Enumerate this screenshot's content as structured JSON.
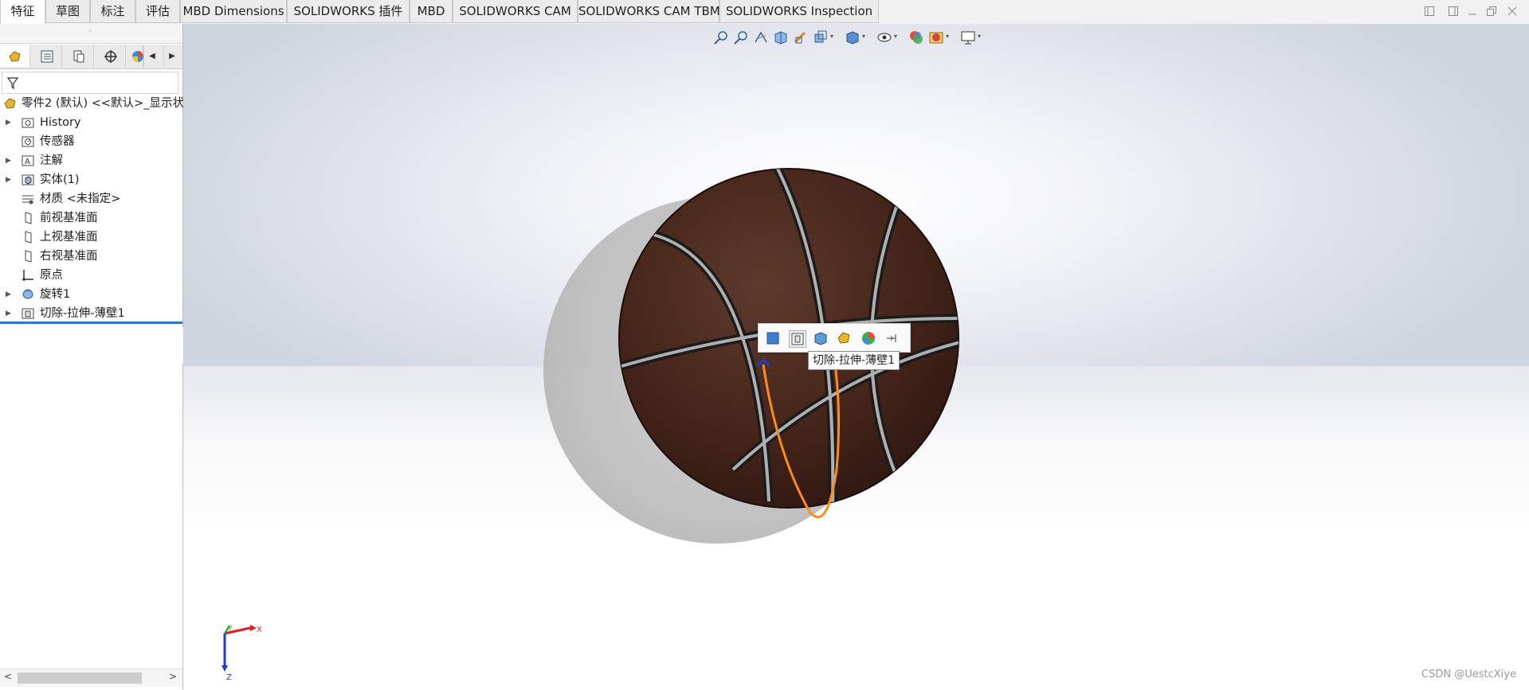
{
  "tabs": [
    {
      "label": "特征",
      "active": true
    },
    {
      "label": "草图"
    },
    {
      "label": "标注"
    },
    {
      "label": "评估"
    },
    {
      "label": "MBD Dimensions"
    },
    {
      "label": "SOLIDWORKS 插件"
    },
    {
      "label": "MBD"
    },
    {
      "label": "SOLIDWORKS CAM"
    },
    {
      "label": "SOLIDWORKS CAM TBM"
    },
    {
      "label": "SOLIDWORKS Inspection"
    }
  ],
  "feature_tree": {
    "root": "零件2 (默认) <<默认>_显示状",
    "items": [
      {
        "label": "History",
        "expandable": true,
        "icon": "history-folder-icon"
      },
      {
        "label": "传感器",
        "expandable": false,
        "icon": "sensor-icon"
      },
      {
        "label": "注解",
        "expandable": true,
        "icon": "annotation-icon"
      },
      {
        "label": "实体(1)",
        "expandable": true,
        "icon": "solid-bodies-icon"
      },
      {
        "label": "材质 <未指定>",
        "expandable": false,
        "icon": "material-icon"
      },
      {
        "label": "前视基准面",
        "expandable": false,
        "icon": "plane-icon"
      },
      {
        "label": "上视基准面",
        "expandable": false,
        "icon": "plane-icon"
      },
      {
        "label": "右视基准面",
        "expandable": false,
        "icon": "plane-icon"
      },
      {
        "label": "原点",
        "expandable": false,
        "icon": "origin-icon"
      },
      {
        "label": "旋转1",
        "expandable": true,
        "icon": "revolve-icon"
      },
      {
        "label": "切除-拉伸-薄壁1",
        "expandable": true,
        "icon": "cut-extrude-icon"
      }
    ]
  },
  "context_toolbar": {
    "tooltip": "切除-拉伸-薄壁1",
    "icons": [
      "edit-feature-icon",
      "edit-sketch-icon",
      "hide-body-icon",
      "appearance-icon",
      "display-pane-icon",
      "pin-icon"
    ]
  },
  "triad": {
    "x": "X",
    "y": "Y",
    "z": "Z"
  },
  "watermark": "CSDN @UestcXiye",
  "colors": {
    "accent": "#2e77c4",
    "ball": "#4a2a20",
    "selection": "#ff8c1a"
  }
}
